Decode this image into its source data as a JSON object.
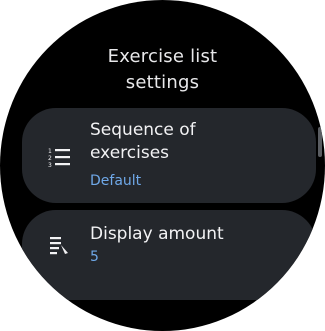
{
  "screen": {
    "title": "Exercise list\nsettings"
  },
  "settings": [
    {
      "label": "Sequence of\nexercises",
      "value": "Default",
      "icon": "numbered-list-icon"
    },
    {
      "label": "Display amount",
      "value": "5",
      "icon": "list-amount-icon"
    }
  ],
  "colors": {
    "background": "#000000",
    "chip": "#24272c",
    "value_accent": "#6fa8e8",
    "text": "#f2f2f4"
  }
}
